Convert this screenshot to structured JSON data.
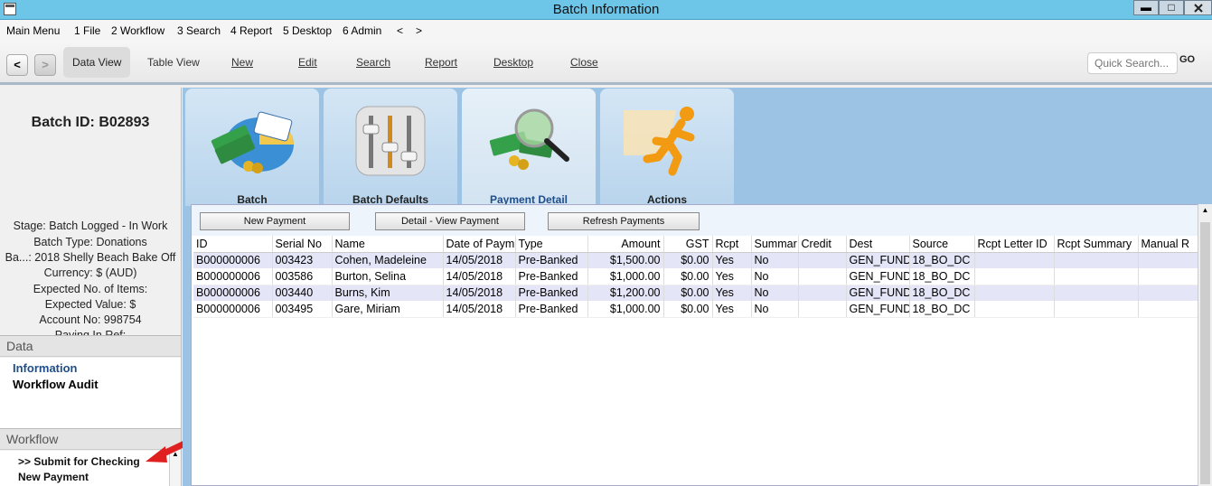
{
  "window": {
    "title": "Batch Information",
    "min_label": "▬",
    "max_label": "□",
    "close_label": ""
  },
  "menu": [
    "Main Menu",
    "1 File",
    "2 Workflow",
    "3 Search",
    "4 Report",
    "5 Desktop",
    "6 Admin",
    "<",
    ">"
  ],
  "toolbar": {
    "back": "<",
    "forward": ">",
    "data_view": "Data View",
    "table_view": "Table View",
    "new": "New",
    "edit": "Edit",
    "search": "Search",
    "report": "Report",
    "desktop": "Desktop",
    "close": "Close",
    "quick_search_placeholder": "Quick Search...",
    "go": "GO"
  },
  "batch": {
    "id": "Batch ID: B02893",
    "stage": "Stage: Batch Logged - In Work",
    "type": "Batch Type: Donations",
    "name": "Ba...: 2018 Shelly Beach Bake Off",
    "currency": "Currency: $ (AUD)",
    "expected_items": "Expected No. of Items:",
    "expected_value": "Expected Value: $",
    "account": "Account No: 998754",
    "paying_in": "Paying In Ref:"
  },
  "data_section": {
    "title": "Data",
    "items": [
      "Information",
      "Workflow Audit"
    ]
  },
  "workflow_section": {
    "title": "Workflow",
    "items": [
      ">> Submit for Checking",
      "New Payment"
    ]
  },
  "tiles": [
    "Batch",
    "Batch Defaults",
    "Payment Detail",
    "Actions"
  ],
  "actions": {
    "new_payment": "New Payment",
    "detail_view": "Detail - View Payment",
    "refresh": "Refresh Payments"
  },
  "table": {
    "columns": [
      "ID",
      "Serial No",
      "Name",
      "Date of Paym",
      "Type",
      "Amount",
      "GST",
      "Rcpt",
      "Summar",
      "Credit",
      "Dest",
      "Source",
      "Rcpt Letter ID",
      "Rcpt Summary",
      "Manual R"
    ],
    "rows": [
      [
        "B000000006",
        "003423",
        "Cohen, Madeleine",
        "14/05/2018",
        "Pre-Banked",
        "$1,500.00",
        "$0.00",
        "Yes",
        "No",
        "",
        "GEN_FUND",
        "18_BO_DC",
        "",
        "",
        ""
      ],
      [
        "B000000006",
        "003586",
        "Burton, Selina",
        "14/05/2018",
        "Pre-Banked",
        "$1,000.00",
        "$0.00",
        "Yes",
        "No",
        "",
        "GEN_FUND",
        "18_BO_DC",
        "",
        "",
        ""
      ],
      [
        "B000000006",
        "003440",
        "Burns, Kim",
        "14/05/2018",
        "Pre-Banked",
        "$1,200.00",
        "$0.00",
        "Yes",
        "No",
        "",
        "GEN_FUND",
        "18_BO_DC",
        "",
        "",
        ""
      ],
      [
        "B000000006",
        "003495",
        "Gare, Miriam",
        "14/05/2018",
        "Pre-Banked",
        "$1,000.00",
        "$0.00",
        "Yes",
        "No",
        "",
        "GEN_FUND",
        "18_BO_DC",
        "",
        "",
        ""
      ]
    ]
  },
  "colors": {
    "titlebar": "#6dc5e8",
    "tile_area": "#9cc3e3",
    "row_highlight": "#e4e6f7",
    "link_blue": "#1f4e8c",
    "arrow_red": "#e02020"
  }
}
